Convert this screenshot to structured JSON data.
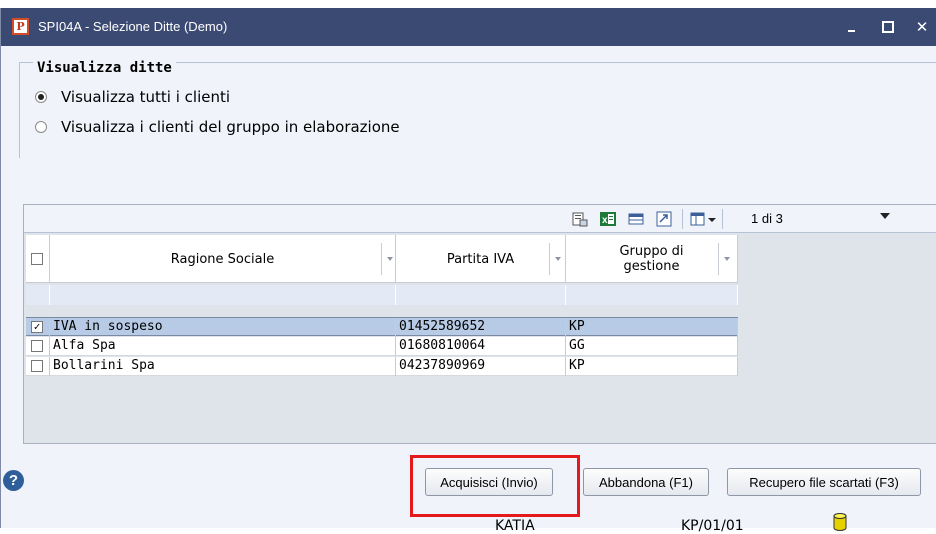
{
  "window": {
    "title": "SPI04A - Selezione Ditte  (Demo)",
    "app_icon_letter": "P",
    "controls": [
      "minimize-icon",
      "maximize-icon",
      "close-icon"
    ]
  },
  "filter_group": {
    "legend": "Visualizza ditte",
    "options": [
      {
        "label": "Visualizza tutti i clienti",
        "selected": true
      },
      {
        "label": "Visualizza i clienti del gruppo in elaborazione",
        "selected": false
      }
    ]
  },
  "grid": {
    "toolbar": {
      "icons": [
        "export-icon",
        "excel-icon",
        "table-icon",
        "refresh-icon",
        "columns-icon"
      ],
      "pager": "1 di 3"
    },
    "columns": [
      {
        "label": "Ragione Sociale"
      },
      {
        "label": "Partita IVA"
      },
      {
        "label": "Gruppo di gestione"
      }
    ],
    "rows": [
      {
        "checked": true,
        "ragione_sociale": "IVA in sospeso",
        "partita_iva": "01452589652",
        "gruppo": "KP",
        "selected": true
      },
      {
        "checked": false,
        "ragione_sociale": "Alfa Spa",
        "partita_iva": "01680810064",
        "gruppo": "GG",
        "selected": false
      },
      {
        "checked": false,
        "ragione_sociale": "Bollarini Spa",
        "partita_iva": "04237890969",
        "gruppo": "KP",
        "selected": false
      }
    ]
  },
  "actions": {
    "acquire": "Acquisisci (Invio)",
    "cancel": "Abbandona (F1)",
    "recover": "Recupero file scartati (F3)"
  },
  "statusbar": {
    "user": "KATIA",
    "code": "KP/01/01"
  },
  "colors": {
    "titlebar": "#3b4a72",
    "highlight": "#e5191c",
    "selected_row": "#b8cbe6"
  }
}
